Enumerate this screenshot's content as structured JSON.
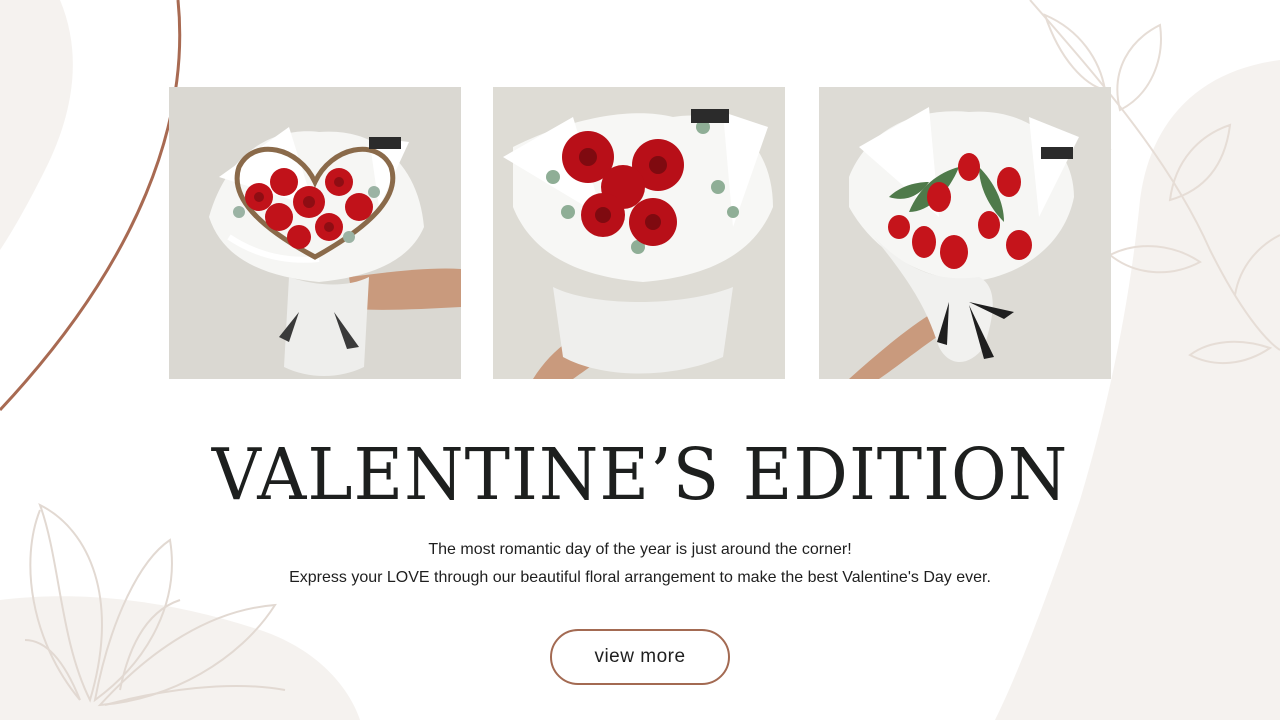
{
  "hero": {
    "title": "VALENTINE’S EDITION",
    "subtitle_line1": "The most romantic day of the year is just around the corner!",
    "subtitle_line2": "Express your LOVE through our beautiful floral arrangement to make the best Valentine's Day ever.",
    "cta_label": "view more"
  },
  "colors": {
    "accent_arc": "#a86a52",
    "background_shape": "#f5f2ef",
    "text": "#1d1f1e",
    "rose_red": "#c1121a"
  }
}
